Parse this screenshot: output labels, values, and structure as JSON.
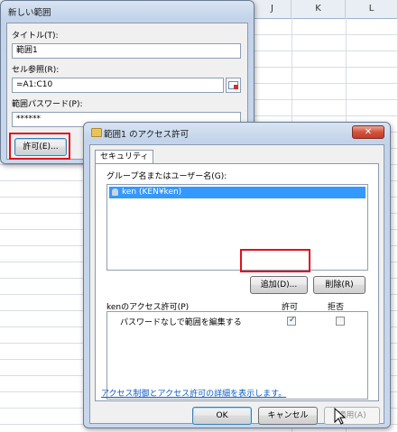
{
  "sheet": {
    "columns": [
      "J",
      "K",
      "L"
    ]
  },
  "new_range_dialog": {
    "title": "新しい範囲",
    "title_label": "タイトル(T):",
    "title_value": "範囲1",
    "ref_label": "セル参照(R):",
    "ref_value": "=A1:C10",
    "password_label": "範囲パスワード(P):",
    "password_value": "******",
    "permissions_button": "許可(E)..."
  },
  "access_dialog": {
    "title": "範囲1 のアクセス許可",
    "close_glyph": "✕",
    "tab": "セキュリティ",
    "group_label": "グループ名またはユーザー名(G):",
    "users": [
      {
        "name": "ken (KEN¥ken)",
        "selected": true
      }
    ],
    "add_button": "追加(D)...",
    "remove_button": "削除(R)",
    "perm_label": "kenのアクセス許可(P)",
    "allow_header": "許可",
    "deny_header": "拒否",
    "permissions": [
      {
        "label": "パスワードなしで範囲を編集する",
        "allow": true,
        "deny": false
      }
    ],
    "info_link": "アクセス制御とアクセス許可の詳細を表示します。",
    "ok_button": "OK",
    "cancel_button": "キャンセル",
    "apply_button": "適用(A)"
  }
}
